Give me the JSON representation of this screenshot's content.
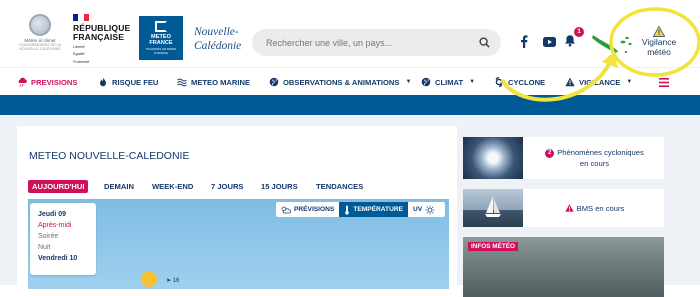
{
  "header": {
    "logo_meteo_climat": {
      "line1": "Météo et climat",
      "line2": "GOUVERNEMENT DE LA",
      "line3": "NOUVELLE-CALÉDONIE"
    },
    "republique": {
      "line1": "RÉPUBLIQUE",
      "line2": "FRANÇAISE",
      "motto1": "Liberté",
      "motto2": "Égalité",
      "motto3": "Fraternité"
    },
    "meteo_france": {
      "line1": "METEO",
      "line2": "FRANCE",
      "tagline": "TOUJOURS UN TEMPS D'AVANCE"
    },
    "nc_title_line1": "Nouvelle-",
    "nc_title_line2": "Calédonie",
    "search": {
      "placeholder": "Rechercher une ville, un pays..."
    },
    "notification_count": "1",
    "vigilance": {
      "line1": "Vigilance",
      "line2": "météo"
    }
  },
  "nav": {
    "items": [
      {
        "label": "PREVISIONS",
        "icon": "rain-cloud-icon"
      },
      {
        "label": "RISQUE FEU",
        "icon": "fire-icon"
      },
      {
        "label": "METEO MARINE",
        "icon": "waves-icon"
      },
      {
        "label": "OBSERVATIONS & ANIMATIONS",
        "icon": "globe-icon"
      },
      {
        "label": "CLIMAT",
        "icon": "globe-icon"
      },
      {
        "label": "CYCLONE",
        "icon": "cyclone-icon"
      },
      {
        "label": "VIGILANCE",
        "icon": "warning-icon"
      }
    ]
  },
  "main": {
    "title": "METEO NOUVELLE-CALEDONIE",
    "tabs": [
      "AUJOURD'HUI",
      "DEMAIN",
      "WEEK-END",
      "7 JOURS",
      "15 JOURS",
      "TENDANCES"
    ],
    "day_panel": {
      "day1": "Jeudi 09",
      "period_active": "Après-midi",
      "period2": "Soirée",
      "period3": "Nuit",
      "day2": "Vendredi 10"
    },
    "view_tabs": [
      "PRÉVISIONS",
      "TEMPÉRATURE",
      "UV"
    ],
    "wind_value": "16"
  },
  "side": {
    "cyclone_badge": "2",
    "cyclone_text1": "Phénomènes cycloniques",
    "cyclone_text2": "en cours",
    "bms_text": "BMS en cours",
    "info_label": "INFOS MÉTÉO"
  },
  "colors": {
    "brand_blue": "#005a96",
    "accent_pink": "#d0105d",
    "navy_text": "#14386a",
    "bg_grey": "#eef1f5"
  }
}
